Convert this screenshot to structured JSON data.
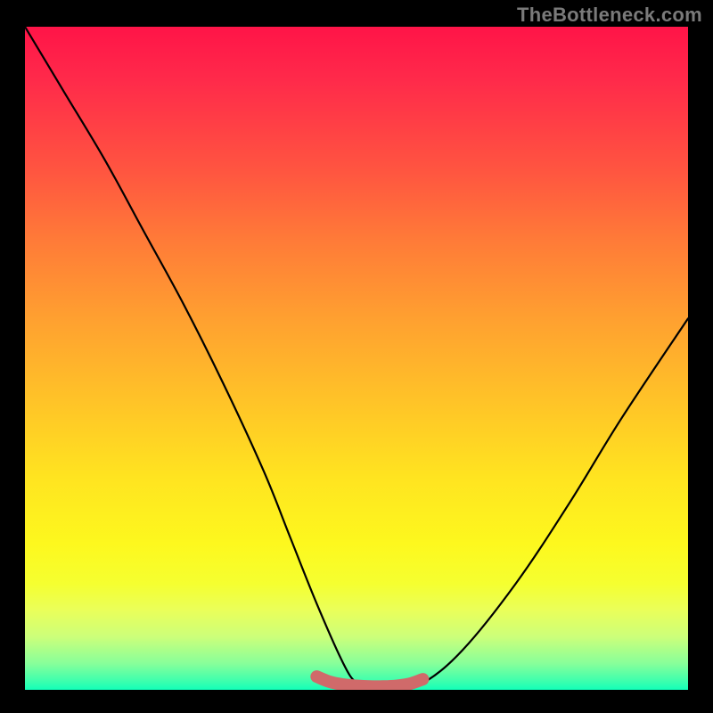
{
  "attribution": "TheBottleneck.com",
  "chart_data": {
    "type": "line",
    "title": "",
    "xlabel": "",
    "ylabel": "",
    "xlim": [
      0,
      100
    ],
    "ylim": [
      0,
      100
    ],
    "series": [
      {
        "name": "curve",
        "x": [
          0,
          6,
          12,
          18,
          24,
          30,
          36,
          40,
          44,
          48,
          50,
          52,
          56,
          60,
          66,
          74,
          82,
          90,
          100
        ],
        "y": [
          100,
          90,
          80,
          69,
          58,
          46,
          33,
          23,
          13,
          4,
          1,
          0,
          0,
          1,
          6,
          16,
          28,
          41,
          56
        ]
      },
      {
        "name": "marker-band",
        "x": [
          44,
          46,
          48,
          50,
          52,
          54,
          56,
          58,
          60
        ],
        "y": [
          2,
          1.2,
          0.8,
          0.6,
          0.5,
          0.5,
          0.6,
          0.9,
          1.6
        ]
      }
    ],
    "colors": {
      "curve": "#000000",
      "marker": "#d06a6a",
      "gradient_top": "#ff1448",
      "gradient_bottom": "#12ffb8"
    }
  }
}
